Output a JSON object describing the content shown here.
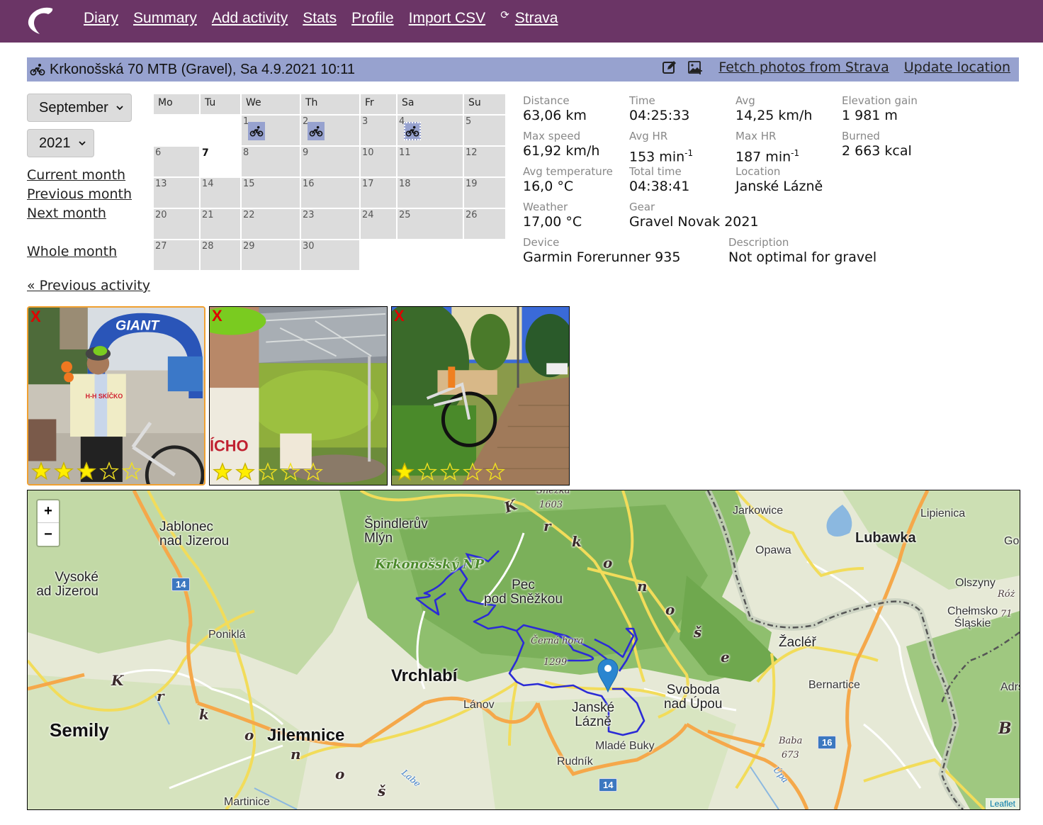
{
  "nav": {
    "items": [
      {
        "label": "Diary"
      },
      {
        "label": "Summary"
      },
      {
        "label": "Add activity"
      },
      {
        "label": "Stats"
      },
      {
        "label": "Profile"
      },
      {
        "label": "Import CSV"
      }
    ],
    "strava": {
      "label": "Strava",
      "icon": "sync-icon"
    }
  },
  "activity": {
    "title": "Krkonošská 70 MTB (Gravel), Sa 4.9.2021 10:11",
    "type_icon": "bicycle-icon",
    "actions": {
      "edit_icon": "edit-icon",
      "add_photo_icon": "add-photo-icon",
      "fetch_photos": "Fetch photos from Strava",
      "update_location": "Update location"
    }
  },
  "calendar": {
    "month_select": {
      "value": "September"
    },
    "year_select": {
      "value": "2021"
    },
    "links": {
      "current_month": "Current month",
      "previous_month": "Previous month",
      "next_month": "Next month",
      "whole_month": "Whole month"
    },
    "weekdays": [
      "Mo",
      "Tu",
      "We",
      "Th",
      "Fr",
      "Sa",
      "Su"
    ],
    "weeks": [
      [
        null,
        null,
        {
          "day": "1",
          "activity": true
        },
        {
          "day": "2",
          "activity": true
        },
        {
          "day": "3"
        },
        {
          "day": "4",
          "activity": true,
          "current": true
        },
        {
          "day": "5"
        }
      ],
      [
        {
          "day": "6"
        },
        {
          "day": "7",
          "today": true
        },
        {
          "day": "8"
        },
        {
          "day": "9"
        },
        {
          "day": "10"
        },
        {
          "day": "11"
        },
        {
          "day": "12"
        }
      ],
      [
        {
          "day": "13"
        },
        {
          "day": "14"
        },
        {
          "day": "15"
        },
        {
          "day": "16"
        },
        {
          "day": "17"
        },
        {
          "day": "18"
        },
        {
          "day": "19"
        }
      ],
      [
        {
          "day": "20"
        },
        {
          "day": "21"
        },
        {
          "day": "22"
        },
        {
          "day": "23"
        },
        {
          "day": "24"
        },
        {
          "day": "25"
        },
        {
          "day": "26"
        }
      ],
      [
        {
          "day": "27"
        },
        {
          "day": "28"
        },
        {
          "day": "29"
        },
        {
          "day": "30"
        },
        null,
        null,
        null
      ]
    ]
  },
  "previous_activity": "« Previous activity",
  "stats": {
    "distance": {
      "label": "Distance",
      "value": "63,06 km"
    },
    "time": {
      "label": "Time",
      "value": "04:25:33"
    },
    "avg": {
      "label": "Avg",
      "value": "14,25 km/h"
    },
    "elevation": {
      "label": "Elevation gain",
      "value": "1 981 m"
    },
    "max_speed": {
      "label": "Max speed",
      "value": "61,92 km/h"
    },
    "avg_hr": {
      "label": "Avg HR",
      "value": "153 min",
      "unit_sup": "-1"
    },
    "max_hr": {
      "label": "Max HR",
      "value": "187 min",
      "unit_sup": "-1"
    },
    "burned": {
      "label": "Burned",
      "value": "2 663 kcal"
    },
    "avg_temp": {
      "label": "Avg temperature",
      "value": "16,0 °C"
    },
    "total_time": {
      "label": "Total time",
      "value": "04:38:41"
    },
    "location": {
      "label": "Location",
      "value": "Janské Lázně"
    },
    "weather": {
      "label": "Weather",
      "value": "17,00 °C"
    },
    "gear": {
      "label": "Gear",
      "value": "Gravel Novak 2021"
    },
    "device": {
      "label": "Device",
      "value": "Garmin Forerunner 935"
    },
    "description": {
      "label": "Description",
      "value": "Not optimal for gravel"
    }
  },
  "photos": [
    {
      "delete_label": "X",
      "rating": 3,
      "max_rating": 5,
      "selected": true,
      "alt": "Cyclist at GIANT finish arch"
    },
    {
      "delete_label": "X",
      "rating": 2,
      "max_rating": 5,
      "selected": false,
      "alt": "Selfie at refreshment tent"
    },
    {
      "delete_label": "X",
      "rating": 1,
      "max_rating": 5,
      "selected": false,
      "alt": "Gravel bike by park bench"
    }
  ],
  "map": {
    "zoom_in": "+",
    "zoom_out": "−",
    "attribution": "Leaflet",
    "labels": {
      "jablonec": "Jablonec\nnad Jizerou",
      "vysoke": "Vysoké\nad Jizerou",
      "spindleruv": "Špindlerův\nMlýn",
      "krkonossky_np": "Krkonošský NP",
      "pec": "Pec\npod Sněžkou",
      "snezka": "Sněžka",
      "snezka_alt": "1603",
      "cerna_hora": "Černá hora",
      "cerna_hora_alt": "1299",
      "jarkowice": "Jarkowice",
      "lipienica": "Lipienica",
      "lubawka": "Lubawka",
      "gor": "Gor",
      "opawa": "Opawa",
      "olszyny": "Olszyny",
      "rog": "Róż",
      "rog_alt": "71",
      "chelmsko": "Chełmsko\nŚląskie",
      "zacler": "Žacléř",
      "bernartice": "Bernartice",
      "adrsp": "Adršp",
      "ponikla": "Poniklá",
      "vrchlabi": "Vrchlabí",
      "lanov": "Lánov",
      "svoboda": "Svoboda\nnad Úpou",
      "janske": "Janské\nLázně",
      "mlade_buky": "Mladé Buky",
      "rudnik": "Rudník",
      "semily": "Semily",
      "jilemnice": "Jilemnice",
      "martinice": "Martinice",
      "baba": "Baba",
      "baba_alt": "673",
      "upa": "Úpa",
      "labe": "Labe",
      "b": "B",
      "road14a": "14",
      "road14b": "14",
      "road16": "16",
      "range_k1": "K",
      "range_r1": "r",
      "range_k2": "k",
      "range_o1": "o",
      "range_n1": "n",
      "range_o2": "o",
      "range_s1": "š",
      "range_e1": "e",
      "range2_k": "K",
      "range2_r": "r",
      "range2_k2": "k",
      "range2_o": "o",
      "range2_n": "n",
      "range2_o2": "o",
      "range2_s": "š"
    }
  }
}
